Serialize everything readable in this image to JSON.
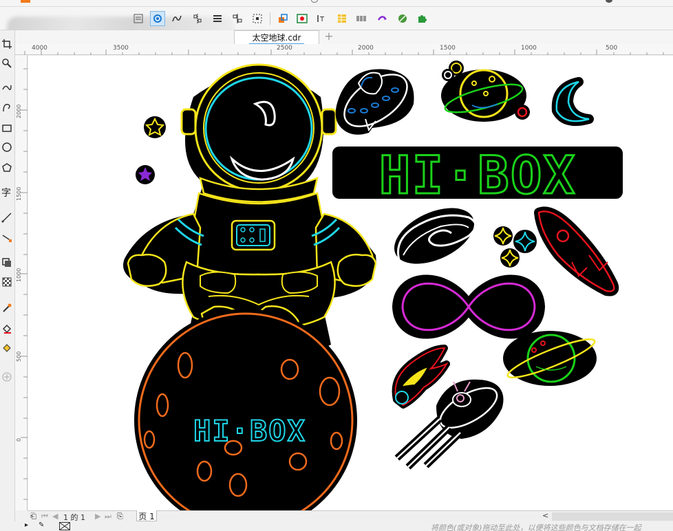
{
  "app": {
    "document_tab": "太空地球.cdr",
    "add_tab": "+"
  },
  "rulers": {
    "top": [
      "4000",
      "3500",
      "2500",
      "2000",
      "1500",
      "1000",
      "500"
    ],
    "left": [
      "2000",
      "1500",
      "1000",
      "500",
      "0"
    ]
  },
  "artwork": {
    "logo_text_top": "HI·BOX",
    "logo_text_planet": "HI·BOX"
  },
  "page_nav": {
    "page_counter": "1 的 1",
    "page_tab": "页 1"
  },
  "status": {
    "hint": "将颜色(或对象)拖动至此处，以便将这些颜色与文档存储在一起"
  },
  "colors": {
    "neon_yellow": "#f5e41a",
    "neon_cyan": "#1fd6e8",
    "neon_green": "#1ad11a",
    "neon_magenta": "#d42ad4",
    "neon_orange": "#f06a1c",
    "neon_red": "#e8121c",
    "accent_blue": "#4aa0e6"
  }
}
